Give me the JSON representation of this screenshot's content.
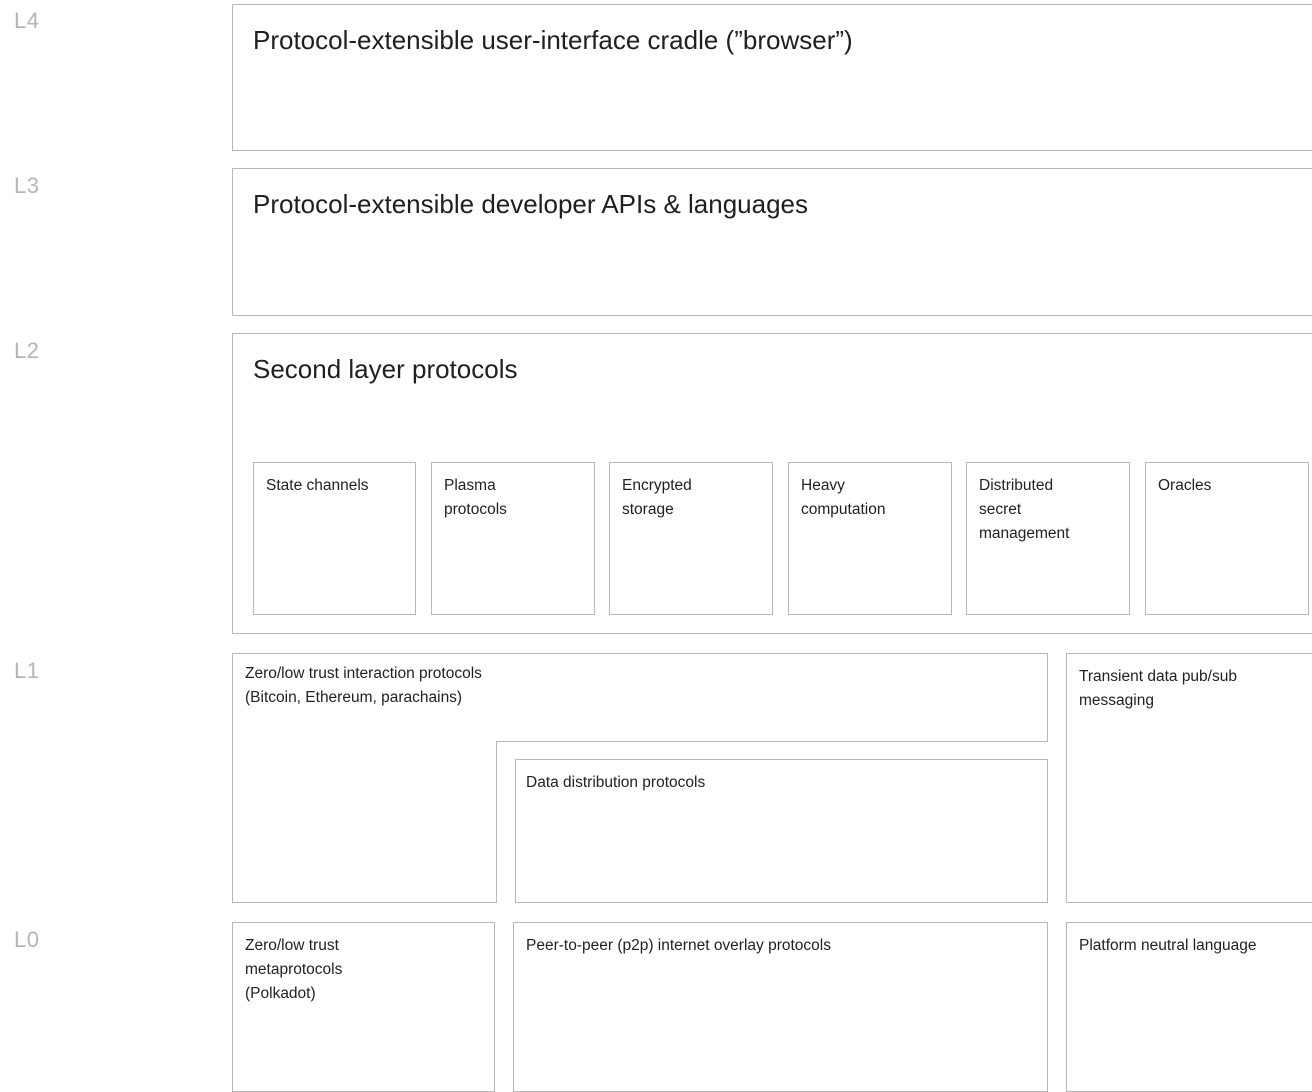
{
  "layers": {
    "L4": {
      "label": "L4",
      "title": "Protocol-extensible user-interface cradle (”browser”)"
    },
    "L3": {
      "label": "L3",
      "title": "Protocol-extensible developer APIs & languages"
    },
    "L2": {
      "label": "L2",
      "title": "Second layer protocols",
      "items": [
        "State channels",
        "Plasma\nprotocols",
        "Encrypted\nstorage",
        "Heavy\ncomputation",
        "Distributed\nsecret\nmanagement",
        "Oracles"
      ]
    },
    "L1": {
      "label": "L1",
      "zero_trust": "Zero/low trust interaction protocols\n(Bitcoin, Ethereum, parachains)",
      "data_distribution": "Data distribution protocols",
      "transient": "Transient data pub/sub\nmessaging"
    },
    "L0": {
      "label": "L0",
      "metaprotocols": "Zero/low trust\nmetaprotocols\n(Polkadot)",
      "p2p": "Peer-to-peer (p2p) internet overlay protocols",
      "platform": "Platform neutral language"
    }
  },
  "colors": {
    "border": "#b8b8b8",
    "label": "#b5b5b5",
    "text": "#1f1f1f"
  }
}
